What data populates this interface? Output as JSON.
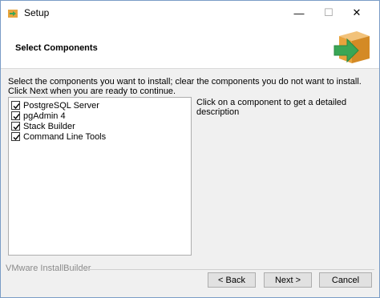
{
  "window": {
    "title": "Setup",
    "minimize_glyph": "—",
    "maximize_glyph": "☐",
    "close_glyph": "✕"
  },
  "header": {
    "title": "Select Components",
    "logo_icon": "install-box-arrow-icon"
  },
  "instructions": "Select the components you want to install; clear the components you do not want to install. Click Next when you are ready to continue.",
  "components": [
    {
      "label": "PostgreSQL Server",
      "checked": true
    },
    {
      "label": "pgAdmin 4",
      "checked": true
    },
    {
      "label": "Stack Builder",
      "checked": true
    },
    {
      "label": "Command Line Tools",
      "checked": true
    }
  ],
  "description": "Click on a component to get a detailed description",
  "footer": {
    "brand": "VMware InstallBuilder",
    "back_label": "< Back",
    "next_label": "Next >",
    "cancel_label": "Cancel"
  },
  "colors": {
    "accent_green": "#3aa655",
    "box_orange": "#e8a33c"
  }
}
